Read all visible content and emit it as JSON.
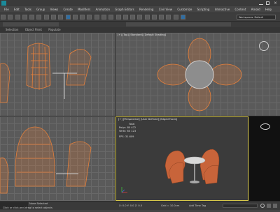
{
  "menu": [
    "File",
    "Edit",
    "Tools",
    "Group",
    "Views",
    "Create",
    "Modifiers",
    "Animation",
    "Graph Editors",
    "Rendering",
    "Civil View",
    "Customize",
    "Scripting",
    "Interactive",
    "Content",
    "Arnold",
    "Help"
  ],
  "workspace_label": "Workspaces: Default",
  "ribbon": [
    "Selection",
    "Object Paint",
    "Populate"
  ],
  "viewports": {
    "top": "[+] [Top] [Standard] [Default Shading]",
    "perspective": "[+] [Perspective] [User Defined] [Edged Faces]"
  },
  "stats": {
    "header": "Total",
    "polys_label": "Polys:",
    "polys_value": "80 472",
    "verts_label": "Verts:",
    "verts_value": "60 123",
    "fps_label": "FPS:",
    "fps_value": "31.609"
  },
  "status": {
    "selection": "None Selected",
    "hint": "Click or click-and-drag to select objects",
    "coords": "X: 0.0  Y: 0.0  Z: 0.0",
    "grid": "Grid = 10.0cm",
    "addtime": "Add Time Tag"
  },
  "colors": {
    "accent": "#e8803a",
    "active_border": "#d8c94a",
    "viewport_bg": "#5a5a5a"
  }
}
